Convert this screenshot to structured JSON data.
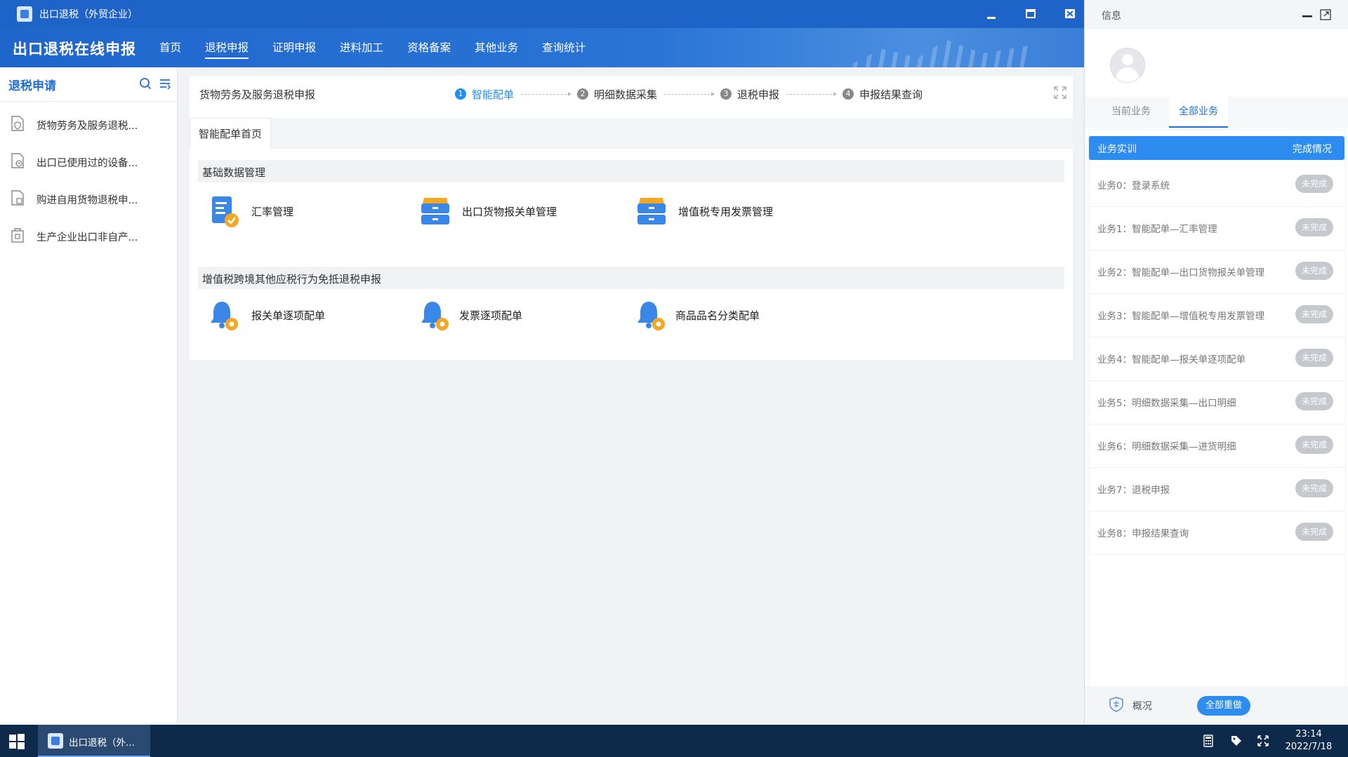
{
  "window": {
    "title": "出口退税（外贸企业）"
  },
  "navbar": {
    "brand": "出口退税在线申报",
    "menu": [
      "首页",
      "退税申报",
      "证明申报",
      "进料加工",
      "资格备案",
      "其他业务",
      "查询统计"
    ],
    "active_index": 1
  },
  "sidebar": {
    "title": "退税申请",
    "items": [
      {
        "label": "货物劳务及服务退税...",
        "icon": "shield-doc-icon"
      },
      {
        "label": "出口已使用过的设备...",
        "icon": "clock-doc-icon"
      },
      {
        "label": "购进自用货物退税申...",
        "icon": "doc-gear-icon"
      },
      {
        "label": "生产企业出口非自产...",
        "icon": "factory-doc-icon"
      }
    ]
  },
  "content": {
    "breadcrumb": "货物劳务及服务退税申报",
    "steps": [
      {
        "num": "1",
        "label": "智能配单",
        "active": true
      },
      {
        "num": "2",
        "label": "明细数据采集",
        "active": false
      },
      {
        "num": "3",
        "label": "退税申报",
        "active": false
      },
      {
        "num": "4",
        "label": "申报结果查询",
        "active": false
      }
    ],
    "tab": "智能配单首页",
    "sections": [
      {
        "title": "基础数据管理",
        "tiles": [
          {
            "label": "汇率管理",
            "icon": "doc-check-icon"
          },
          {
            "label": "出口货物报关单管理",
            "icon": "database-icon"
          },
          {
            "label": "增值税专用发票管理",
            "icon": "database-icon"
          }
        ]
      },
      {
        "title": "增值税跨境其他应税行为免抵退税申报",
        "tiles": [
          {
            "label": "报关单逐项配单",
            "icon": "bell-gear-icon"
          },
          {
            "label": "发票逐项配单",
            "icon": "bell-gear-icon"
          },
          {
            "label": "商品品名分类配单",
            "icon": "bell-gear-icon"
          }
        ]
      }
    ]
  },
  "info": {
    "title": "信息",
    "tabs": [
      "当前业务",
      "全部业务"
    ],
    "active_tab": 1,
    "table": {
      "col1": "业务实训",
      "col2": "完成情况"
    },
    "rows": [
      {
        "name": "业务0：登录系统",
        "status": "未完成"
      },
      {
        "name": "业务1：智能配单—汇率管理",
        "status": "未完成"
      },
      {
        "name": "业务2：智能配单—出口货物报关单管理",
        "status": "未完成"
      },
      {
        "name": "业务3：智能配单—增值税专用发票管理",
        "status": "未完成"
      },
      {
        "name": "业务4：智能配单—报关单逐项配单",
        "status": "未完成"
      },
      {
        "name": "业务5：明细数据采集—出口明细",
        "status": "未完成"
      },
      {
        "name": "业务6：明细数据采集—进货明细",
        "status": "未完成"
      },
      {
        "name": "业务7：退税申报",
        "status": "未完成"
      },
      {
        "name": "业务8：申报结果查询",
        "status": "未完成"
      }
    ],
    "footer": {
      "overview": "概况",
      "redo_all": "全部重做"
    }
  },
  "taskbar": {
    "app_label": "出口退税（外...",
    "time": "23:14",
    "date": "2022/7/18"
  },
  "colors": {
    "primary": "#1e63c8",
    "accent": "#2d8cf0",
    "step_active": "#1e8ef5",
    "badge": "#c5c8cd",
    "taskbar": "#0e2a4a"
  }
}
